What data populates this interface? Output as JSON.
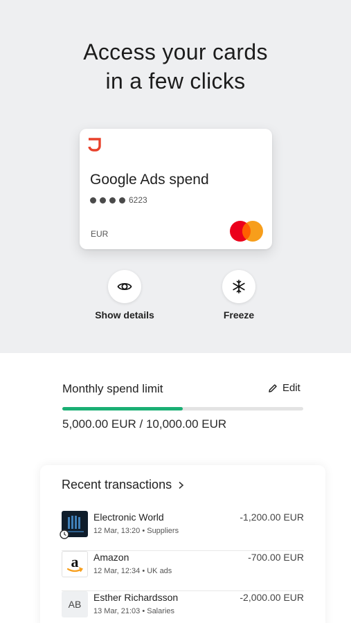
{
  "headline": {
    "line1": "Access your cards",
    "line2": "in a few clicks"
  },
  "card": {
    "name": "Google Ads spend",
    "last_four": "6223",
    "currency": "EUR",
    "brand_icon": "mastercard-icon",
    "colors": {
      "logo": "#e8412b",
      "mc_red": "#eb001b",
      "mc_orange": "#f79e1b"
    }
  },
  "actions": [
    {
      "label": "Show details",
      "icon": "eye-icon"
    },
    {
      "label": "Freeze",
      "icon": "snowflake-icon"
    }
  ],
  "spend_limit": {
    "title": "Monthly spend limit",
    "edit_label": "Edit",
    "values_text": "5,000.00 EUR /  10,000.00 EUR",
    "progress_fraction": 0.5,
    "bar_color": "#1aaf74"
  },
  "transactions": {
    "title": "Recent transactions",
    "items": [
      {
        "merchant": "Electronic World",
        "meta": "12 Mar, 13:20 • Suppliers",
        "amount": "-1,200.00 EUR",
        "icon": "store-logo"
      },
      {
        "merchant": "Amazon",
        "meta": "12 Mar, 12:34 • UK ads",
        "amount": "-700.00 EUR",
        "icon": "amazon-logo"
      },
      {
        "merchant": "Esther Richardsson",
        "meta": "13 Mar, 21:03 • Salaries",
        "amount": "-2,000.00 EUR",
        "initials": "AB"
      }
    ]
  }
}
